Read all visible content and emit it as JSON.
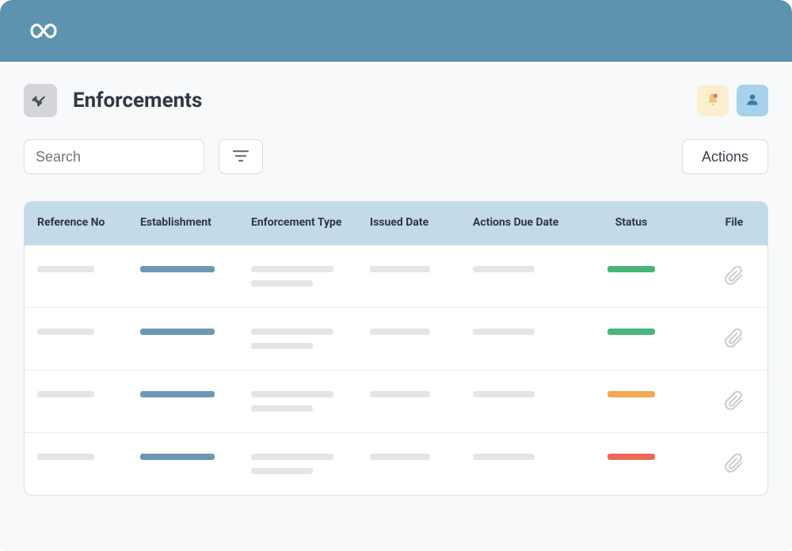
{
  "page": {
    "title": "Enforcements"
  },
  "search": {
    "placeholder": "Search"
  },
  "buttons": {
    "actions": "Actions"
  },
  "table": {
    "headers": {
      "ref": "Reference No",
      "establishment": "Establishment",
      "enforcementType": "Enforcement Type",
      "issuedDate": "Issued Date",
      "actionsDue": "Actions Due Date",
      "status": "Status",
      "file": "File"
    },
    "rows": [
      {
        "statusColor": "green"
      },
      {
        "statusColor": "green"
      },
      {
        "statusColor": "orange"
      },
      {
        "statusColor": "red"
      }
    ]
  },
  "colors": {
    "brand": "#5d93ae",
    "headerBg": "#c3dbe9",
    "skeleton": "#e3e6e9",
    "establishment": "#6d98b3",
    "statusGreen": "#48b57a",
    "statusOrange": "#f0a94d",
    "statusRed": "#ec6a58"
  },
  "icons": {
    "logo": "infinity-icon",
    "pageIcon": "gavel-icon",
    "bell": "bell-icon",
    "user": "user-icon",
    "filter": "filter-icon",
    "attachment": "paperclip-icon"
  }
}
